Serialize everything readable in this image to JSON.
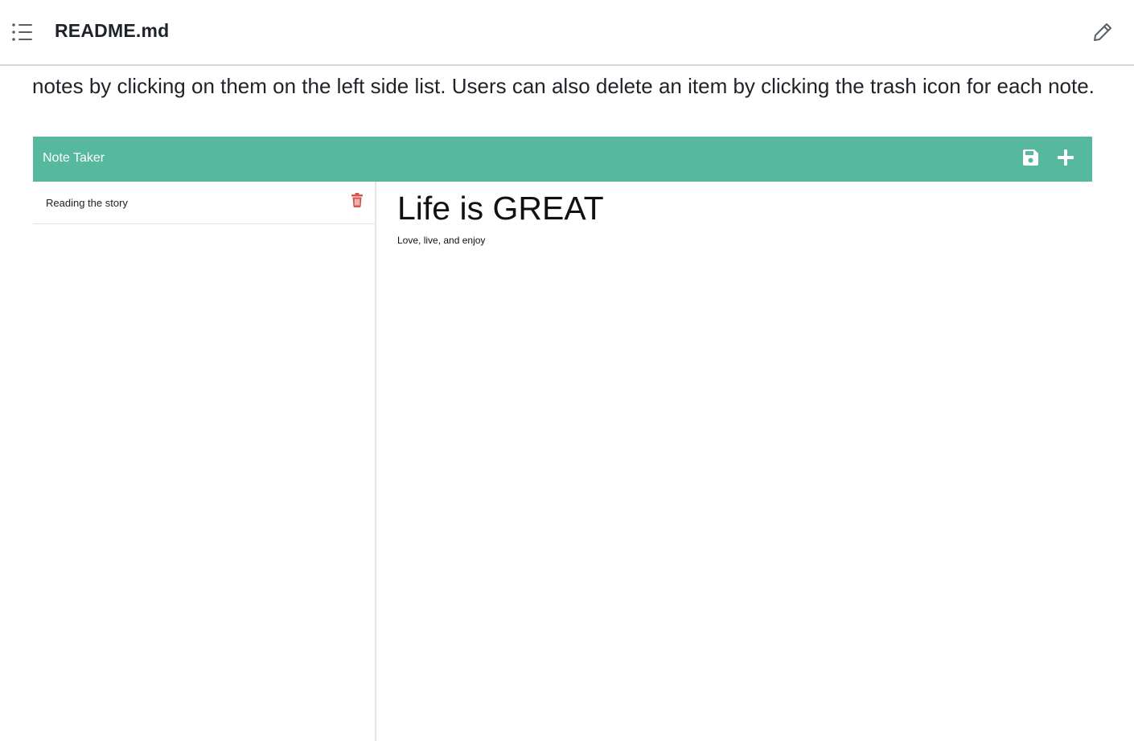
{
  "header": {
    "file_title": "README.md",
    "toc_icon": "list-icon",
    "edit_icon": "pencil-icon"
  },
  "readme": {
    "text": "notes by clicking on them on the left side list. Users can also delete an item by clicking the trash icon for each note."
  },
  "app": {
    "brand": "Note Taker",
    "accent_color": "#56b89c",
    "actions": {
      "save_icon": "save-icon",
      "new_icon": "plus-icon"
    },
    "notes": [
      {
        "title": "Reading the story",
        "delete_icon": "trash-icon",
        "delete_color": "#d9534f"
      }
    ],
    "editor": {
      "title_value": "Life is GREAT",
      "body_value": "Love, live, and enjoy"
    }
  }
}
